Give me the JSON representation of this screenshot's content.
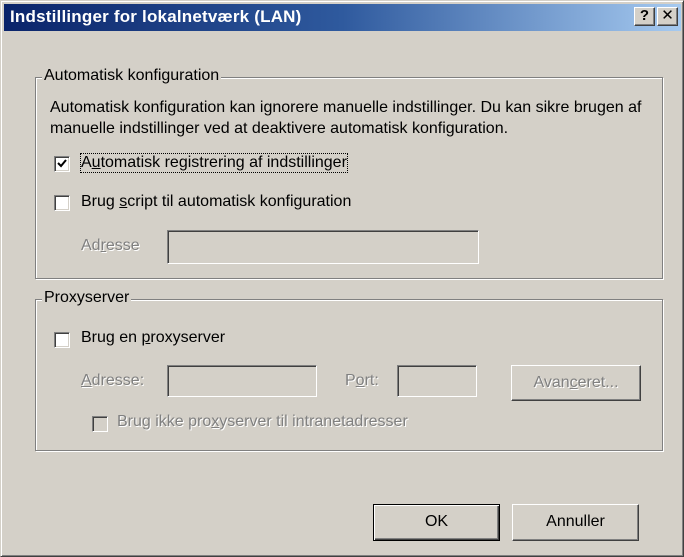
{
  "window": {
    "title": "Indstillinger for lokalnetværk (LAN)",
    "help_label": "?",
    "close_label": "✕"
  },
  "auto_config": {
    "legend": "Automatisk konfiguration",
    "description": "Automatisk konfiguration kan ignorere manuelle indstillinger. Du kan sikre brugen af manuelle indstillinger ved at deaktivere automatisk konfiguration.",
    "auto_detect": {
      "pre": "A",
      "key": "u",
      "post": "tomatisk registrering af indstillinger",
      "checked": true
    },
    "use_script": {
      "pre": "Brug ",
      "key": "s",
      "post": "cript til automatisk konfiguration",
      "checked": false
    },
    "address": {
      "pre": "Ad",
      "key": "r",
      "post": "esse",
      "value": ""
    }
  },
  "proxy": {
    "legend": "Proxyserver",
    "use_proxy": {
      "pre": "Brug en ",
      "key": "p",
      "post": "roxyserver",
      "checked": false
    },
    "address": {
      "pre": "",
      "key": "A",
      "post": "dresse:",
      "value": ""
    },
    "port": {
      "pre": "P",
      "key": "o",
      "post": "rt:",
      "value": ""
    },
    "advanced": {
      "pre": "Avan",
      "key": "c",
      "post": "eret..."
    },
    "bypass": {
      "pre": "Brug ikke pro",
      "key": "x",
      "post": "yserver til intranetadresser",
      "checked": false
    }
  },
  "buttons": {
    "ok": "OK",
    "cancel": "Annuller"
  }
}
